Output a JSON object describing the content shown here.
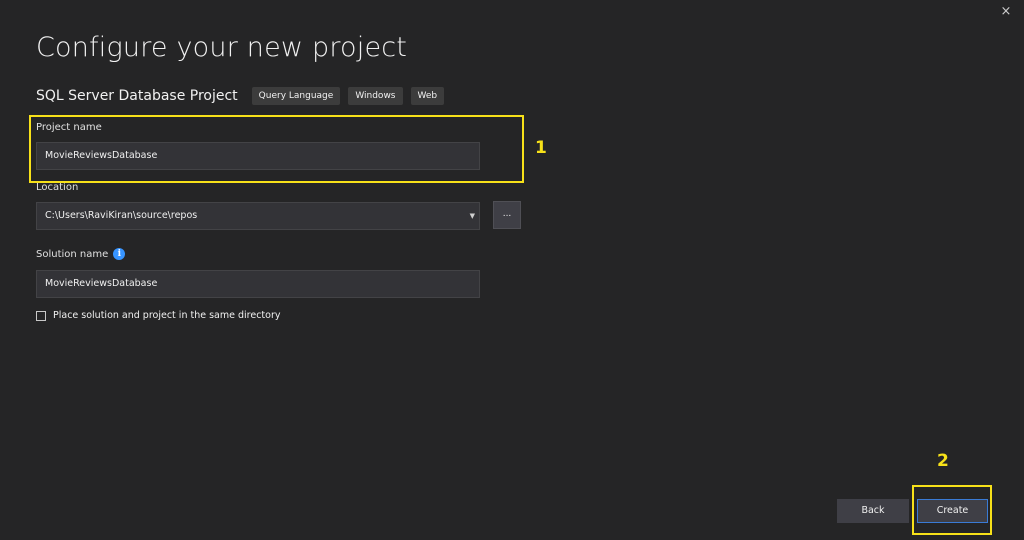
{
  "window": {
    "close_label": "×"
  },
  "header": {
    "title": "Configure your new project",
    "project_type": "SQL Server Database Project",
    "tags": [
      "Query Language",
      "Windows",
      "Web"
    ]
  },
  "form": {
    "project_name": {
      "label": "Project name",
      "value": "MovieReviewsDatabase"
    },
    "location": {
      "label": "Location",
      "value": "C:\\Users\\RaviKiran\\source\\repos",
      "browse_label": "..."
    },
    "solution_name": {
      "label": "Solution name",
      "value": "MovieReviewsDatabase",
      "info_icon": "i"
    },
    "same_directory": {
      "label": "Place solution and project in the same directory",
      "checked": false
    }
  },
  "annotations": {
    "marker1": "1",
    "marker2": "2",
    "color": "#f7e119"
  },
  "footer": {
    "back_label": "Back",
    "create_label": "Create"
  }
}
